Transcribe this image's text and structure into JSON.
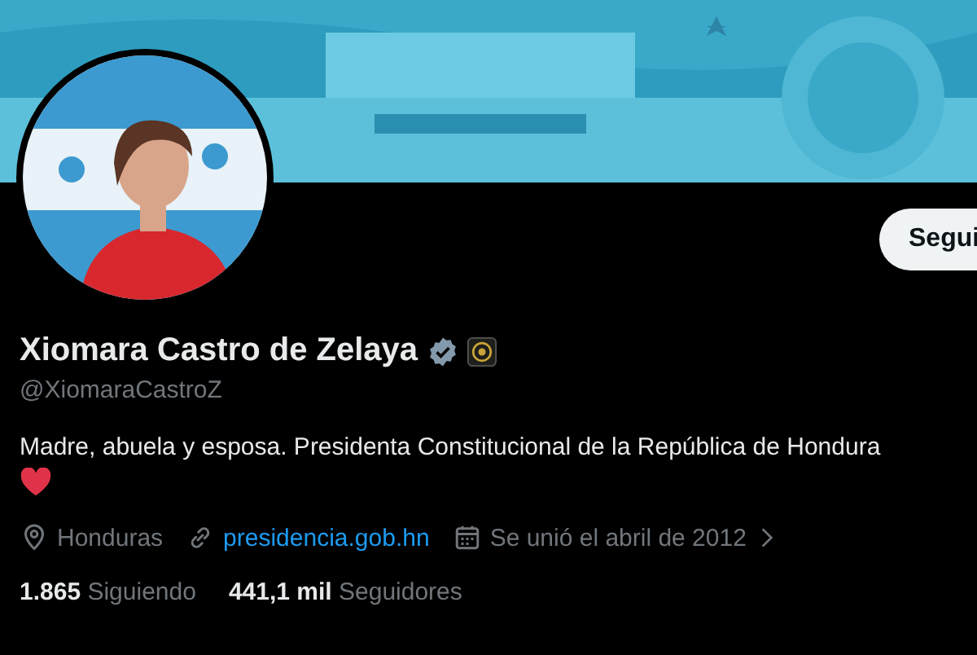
{
  "follow_button": {
    "label": "Segui"
  },
  "profile": {
    "name": "Xiomara Castro de Zelaya",
    "verified": true,
    "handle": "@XiomaraCastroZ",
    "bio": "Madre, abuela y esposa. Presidenta Constitucional de la República de Hondura"
  },
  "meta": [
    {
      "kind": "location",
      "text": "Honduras"
    },
    {
      "kind": "link",
      "text": "presidencia.gob.hn"
    },
    {
      "kind": "joined",
      "text": "Se unió el abril de 2012"
    }
  ],
  "stats": [
    {
      "count": "1.865",
      "label": "Siguiendo"
    },
    {
      "count": "441,1 mil",
      "label": "Seguidores"
    }
  ]
}
